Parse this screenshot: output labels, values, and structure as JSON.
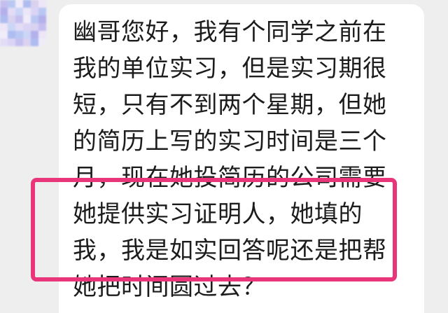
{
  "sender": {
    "avatar_colors": [
      "#d9d2f0",
      "#b9c8f2",
      "#ece6f8",
      "#c5bff0",
      "#e2dcf6",
      "#aebcf0",
      "#cbd6f6",
      "#f0ecfa",
      "#b4b0ec",
      "#dcd4f4"
    ]
  },
  "message": {
    "lines": [
      "幽哥您好，我有个同学之前在",
      "我的单位实习，但是实习期很",
      "短，只有不到两个星期，但她",
      "的简历上写的实习时间是三个",
      "月，现在她投简历的公司需要",
      "她提供实习证明人，她填的",
      "我，我是如实回答呢还是把帮",
      "她把时间圆过去？"
    ]
  },
  "highlight": {
    "color": "#e9367a"
  }
}
